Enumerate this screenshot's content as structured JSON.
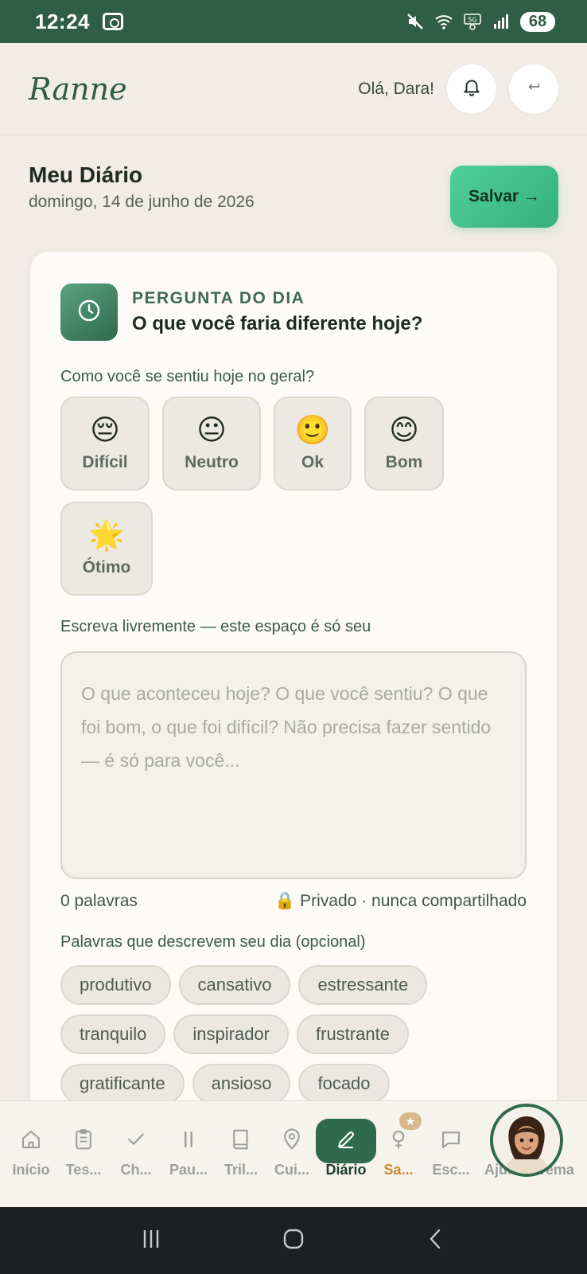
{
  "status_bar": {
    "time": "12:24",
    "battery": "68"
  },
  "header": {
    "brand": "Ranne",
    "greeting": "Olá, Dara!"
  },
  "page": {
    "title": "Meu Diário",
    "date": "domingo, 14 de junho de 2026",
    "save_label": "Salvar →"
  },
  "question_of_day": {
    "label": "PERGUNTA DO DIA",
    "question": "O que você faria diferente hoje?"
  },
  "mood": {
    "prompt": "Como você se sentiu hoje no geral?",
    "options": [
      {
        "emoji": "😔",
        "label": "Difícil"
      },
      {
        "emoji": "😐",
        "label": "Neutro"
      },
      {
        "emoji": "🙂",
        "label": "Ok"
      },
      {
        "emoji": "😊",
        "label": "Bom"
      },
      {
        "emoji": "🌟",
        "label": "Ótimo"
      }
    ]
  },
  "journal": {
    "prompt": "Escreva livremente — este espaço é só seu",
    "placeholder": "O que aconteceu hoje? O que você sentiu? O que foi bom, o que foi difícil? Não precisa fazer sentido — é só para você...",
    "value": "",
    "word_count": "0 palavras",
    "privacy": "🔒 Privado · nunca compartilhado"
  },
  "tags": {
    "prompt": "Palavras que descrevem seu dia (opcional)",
    "items": [
      "produtivo",
      "cansativo",
      "estressante",
      "tranquilo",
      "inspirador",
      "frustrante",
      "gratificante",
      "ansioso",
      "focado"
    ]
  },
  "bottom_nav": {
    "items": [
      {
        "label": "Início",
        "icon": "home-icon"
      },
      {
        "label": "Tes...",
        "icon": "clipboard-icon"
      },
      {
        "label": "Ch...",
        "icon": "check-icon"
      },
      {
        "label": "Pau...",
        "icon": "pause-icon"
      },
      {
        "label": "Tril...",
        "icon": "book-icon"
      },
      {
        "label": "Cui...",
        "icon": "map-pin-icon"
      },
      {
        "label": "Diário",
        "icon": "pen-icon"
      },
      {
        "label": "Sa...",
        "icon": "female-icon"
      },
      {
        "label": "Esc...",
        "icon": "chat-icon"
      },
      {
        "label": "Aju...",
        "icon": "help-icon"
      },
      {
        "label": "Tema",
        "icon": "theme-icon"
      }
    ],
    "badge": "★"
  },
  "colors": {
    "brand_green": "#2f5d45",
    "accent_mint": "#4fcf9a",
    "highlight_orange": "#c98a2b"
  }
}
